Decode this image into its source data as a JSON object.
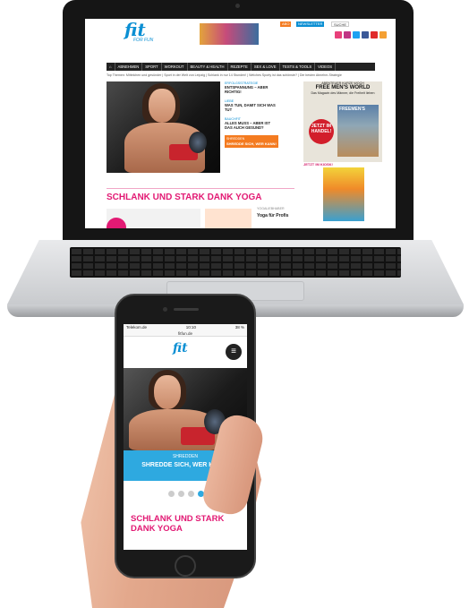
{
  "laptop": {
    "site": {
      "logo": "fit",
      "tagline": "FOR FUN",
      "top_buttons": [
        "ABO",
        "NEWSLETTER",
        "SUCHE"
      ],
      "social_colors": [
        "#e8407a",
        "#c13584",
        "#1da1f2",
        "#3b5998",
        "#e02a2a",
        "#f4a033"
      ],
      "nav": [
        "ABNEHMEN",
        "SPORT",
        "WORKOUT",
        "BEAUTY & HEALTH",
        "REZEPTE",
        "SEX & LOVE",
        "TESTS & TOOLS",
        "VIDEOS"
      ],
      "breadcrumb": "Top Themen: Mittelchen und gesünder | Sport in der Welt von Leipzig | Schlank in nur 14 Stunden! | Welches Sporty ist das schönste? | Die besten Abnehm-Strategie",
      "side": [
        {
          "kicker": "ERFOLGSSTRATEGIE",
          "title": "ENTSPANNUNG – ABER RICHTIG!"
        },
        {
          "kicker": "LIEBE",
          "title": "WAS TUN, DAMIT SICH WAS TUT"
        },
        {
          "kicker": "BAUCHFIT",
          "title": "ALLES MUSS – ABER IST DAS AUCH GESUND?"
        }
      ],
      "orange_kicker": "SHREDDEN",
      "orange_title": "SHREDDE SICH, WER KANN!",
      "ad": {
        "top": "ABENTEUER KURZE WOCH",
        "big": "FREE MEN'S WORLD",
        "sub": "Das Magazin des Männer, die Freiheit lieben",
        "cover": "FREEMEN'S",
        "button": "JETZT IM HANDEL!"
      },
      "jetzt": "JETZT IM KIOSK!",
      "headline": "SCHLANK UND STARK DANK YOGA",
      "box_kicker": "YOGALIEBHABER",
      "box_title": "Yoga für Profis"
    }
  },
  "phone": {
    "status": {
      "carrier": "Telekom.de",
      "time": "10:10",
      "battery": "38 %"
    },
    "url": "fitfun.de",
    "logo": "fit",
    "menu_icon": "≡",
    "hero": {
      "kicker": "SHREDDEN",
      "title": "SHREDDE SICH, WER KANN!"
    },
    "dots": 4,
    "active_dot": 4,
    "headline": "SCHLANK UND STARK DANK YOGA"
  }
}
